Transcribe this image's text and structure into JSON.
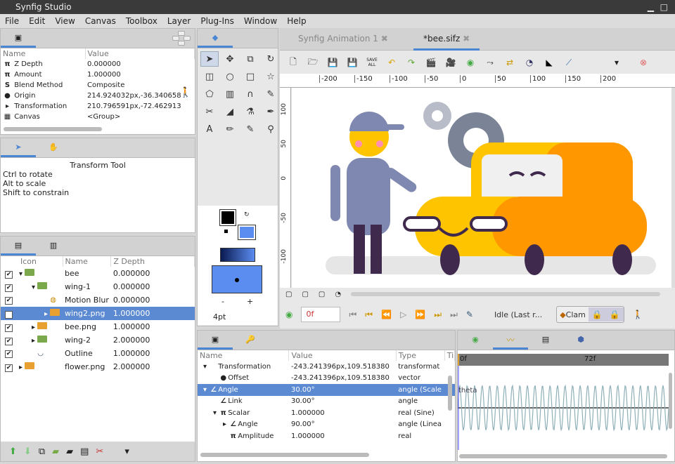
{
  "window": {
    "title": "Synfig Studio"
  },
  "menu": [
    "File",
    "Edit",
    "View",
    "Canvas",
    "Toolbox",
    "Layer",
    "Plug-Ins",
    "Window",
    "Help"
  ],
  "params_top": {
    "headers": [
      "Name",
      "Value"
    ],
    "rows": [
      {
        "icon": "π",
        "name": "Z Depth",
        "value": "0.000000"
      },
      {
        "icon": "π",
        "name": "Amount",
        "value": "1.000000"
      },
      {
        "icon": "S",
        "name": "Blend Method",
        "value": "Composite"
      },
      {
        "icon": "●",
        "name": "Origin",
        "value": "214.924032px,-36.340658"
      },
      {
        "icon": "▸",
        "name": "Transformation",
        "value": "210.796591px,-72.462913"
      },
      {
        "icon": "▦",
        "name": "Canvas",
        "value": "<Group>"
      }
    ]
  },
  "tool_options": {
    "title": "Transform Tool",
    "lines": [
      "Ctrl to rotate",
      "Alt to scale",
      "Shift to constrain"
    ]
  },
  "layers": {
    "headers": [
      "Icon",
      "Name",
      "Z Depth"
    ],
    "rows": [
      {
        "name": "bee",
        "z": "0.000000",
        "indent": 0,
        "exp": "▾",
        "type": "folder",
        "sel": false
      },
      {
        "name": "wing-1",
        "z": "0.000000",
        "indent": 1,
        "exp": "▾",
        "type": "folder",
        "sel": false
      },
      {
        "name": "Motion Blur",
        "z": "0.000000",
        "indent": 2,
        "exp": "",
        "type": "blur",
        "sel": false
      },
      {
        "name": "wing2.png",
        "z": "1.000000",
        "indent": 2,
        "exp": "▸",
        "type": "image",
        "sel": true
      },
      {
        "name": "bee.png",
        "z": "1.000000",
        "indent": 1,
        "exp": "▸",
        "type": "image",
        "sel": false
      },
      {
        "name": "wing-2",
        "z": "2.000000",
        "indent": 1,
        "exp": "▸",
        "type": "folder",
        "sel": false
      },
      {
        "name": "Outline",
        "z": "1.000000",
        "indent": 1,
        "exp": "",
        "type": "outline",
        "sel": false
      },
      {
        "name": "flower.png",
        "z": "2.000000",
        "indent": 0,
        "exp": "▸",
        "type": "image",
        "sel": false
      }
    ]
  },
  "toolbox": {
    "brush_size": "4pt",
    "minus": "-",
    "plus": "+"
  },
  "canvas": {
    "tabs": [
      "Synfig Animation 1",
      "*bee.sifz"
    ],
    "active_tab": 1,
    "save_all": "SAVE ALL",
    "ruler_x": [
      "-200",
      "-150",
      "-100",
      "-50",
      "0",
      "50",
      "100",
      "150",
      "200"
    ],
    "ruler_y": [
      "100",
      "50",
      "0",
      "-50",
      "-100"
    ],
    "frame": "0f",
    "status": "Idle (Last r...",
    "clamp": "Clam"
  },
  "params_bottom": {
    "headers": [
      "Name",
      "Value",
      "Type",
      "Ti"
    ],
    "rows": [
      {
        "indent": 0,
        "exp": "▾",
        "icon": "",
        "name": "Transformation",
        "value": "-243.241396px,109.518380",
        "type": "transformat",
        "sel": false
      },
      {
        "indent": 1,
        "exp": "",
        "icon": "●",
        "name": "Offset",
        "value": "-243.241396px,109.518380",
        "type": "vector",
        "sel": false
      },
      {
        "indent": 0,
        "exp": "▾",
        "icon": "∠",
        "name": "Angle",
        "value": "30.00°",
        "type": "angle (Scale",
        "sel": true
      },
      {
        "indent": 1,
        "exp": "",
        "icon": "∠",
        "name": "Link",
        "value": "30.00°",
        "type": "angle",
        "sel": false
      },
      {
        "indent": 1,
        "exp": "▾",
        "icon": "π",
        "name": "Scalar",
        "value": "1.000000",
        "type": "real (Sine)",
        "sel": false
      },
      {
        "indent": 2,
        "exp": "▸",
        "icon": "∠",
        "name": "Angle",
        "value": "90.00°",
        "type": "angle (Linea",
        "sel": false
      },
      {
        "indent": 2,
        "exp": "",
        "icon": "π",
        "name": "Amplitude",
        "value": "1.000000",
        "type": "real",
        "sel": false
      }
    ]
  },
  "graphs": {
    "start_label": "0f",
    "mid_label": "72f",
    "curve_label": "theta",
    "cycles": 28
  },
  "colors": {
    "accent": "#4a86d4",
    "selection": "#5b8ad3",
    "yellow": "#ffc400",
    "orange": "#ff9800",
    "fill": "#5b8cf0"
  }
}
